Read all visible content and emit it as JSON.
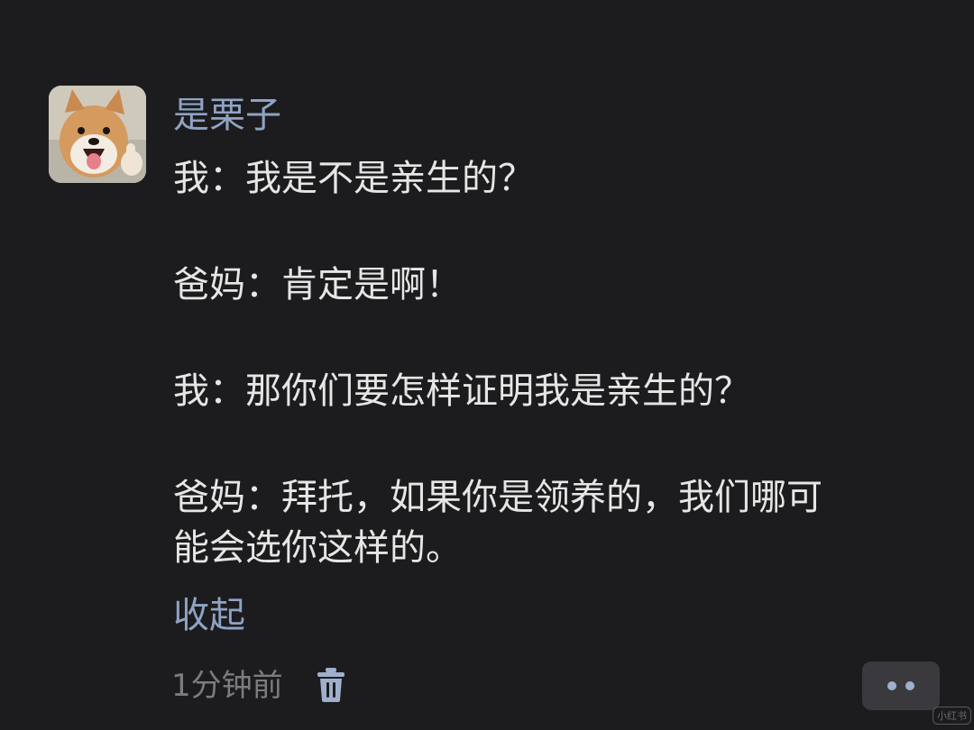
{
  "comment": {
    "author": "是栗子",
    "lines": [
      "我：我是不是亲生的？",
      "爸妈：肯定是啊！",
      "我：那你们要怎样证明我是亲生的？",
      "爸妈：拜托，如果你是领养的，我们哪可",
      "能会选你这样的。"
    ],
    "collapse_label": "收起",
    "timestamp": "1分钟前",
    "avatar_icon": "shiba-dog-avatar",
    "delete_icon": "trash-icon",
    "more_icon": "more-dots-icon"
  },
  "watermark": "小红书",
  "colors": {
    "background": "#1c1c1e",
    "author": "#8fa3c4",
    "text": "#e6e6e6",
    "meta": "#7c7c80"
  }
}
